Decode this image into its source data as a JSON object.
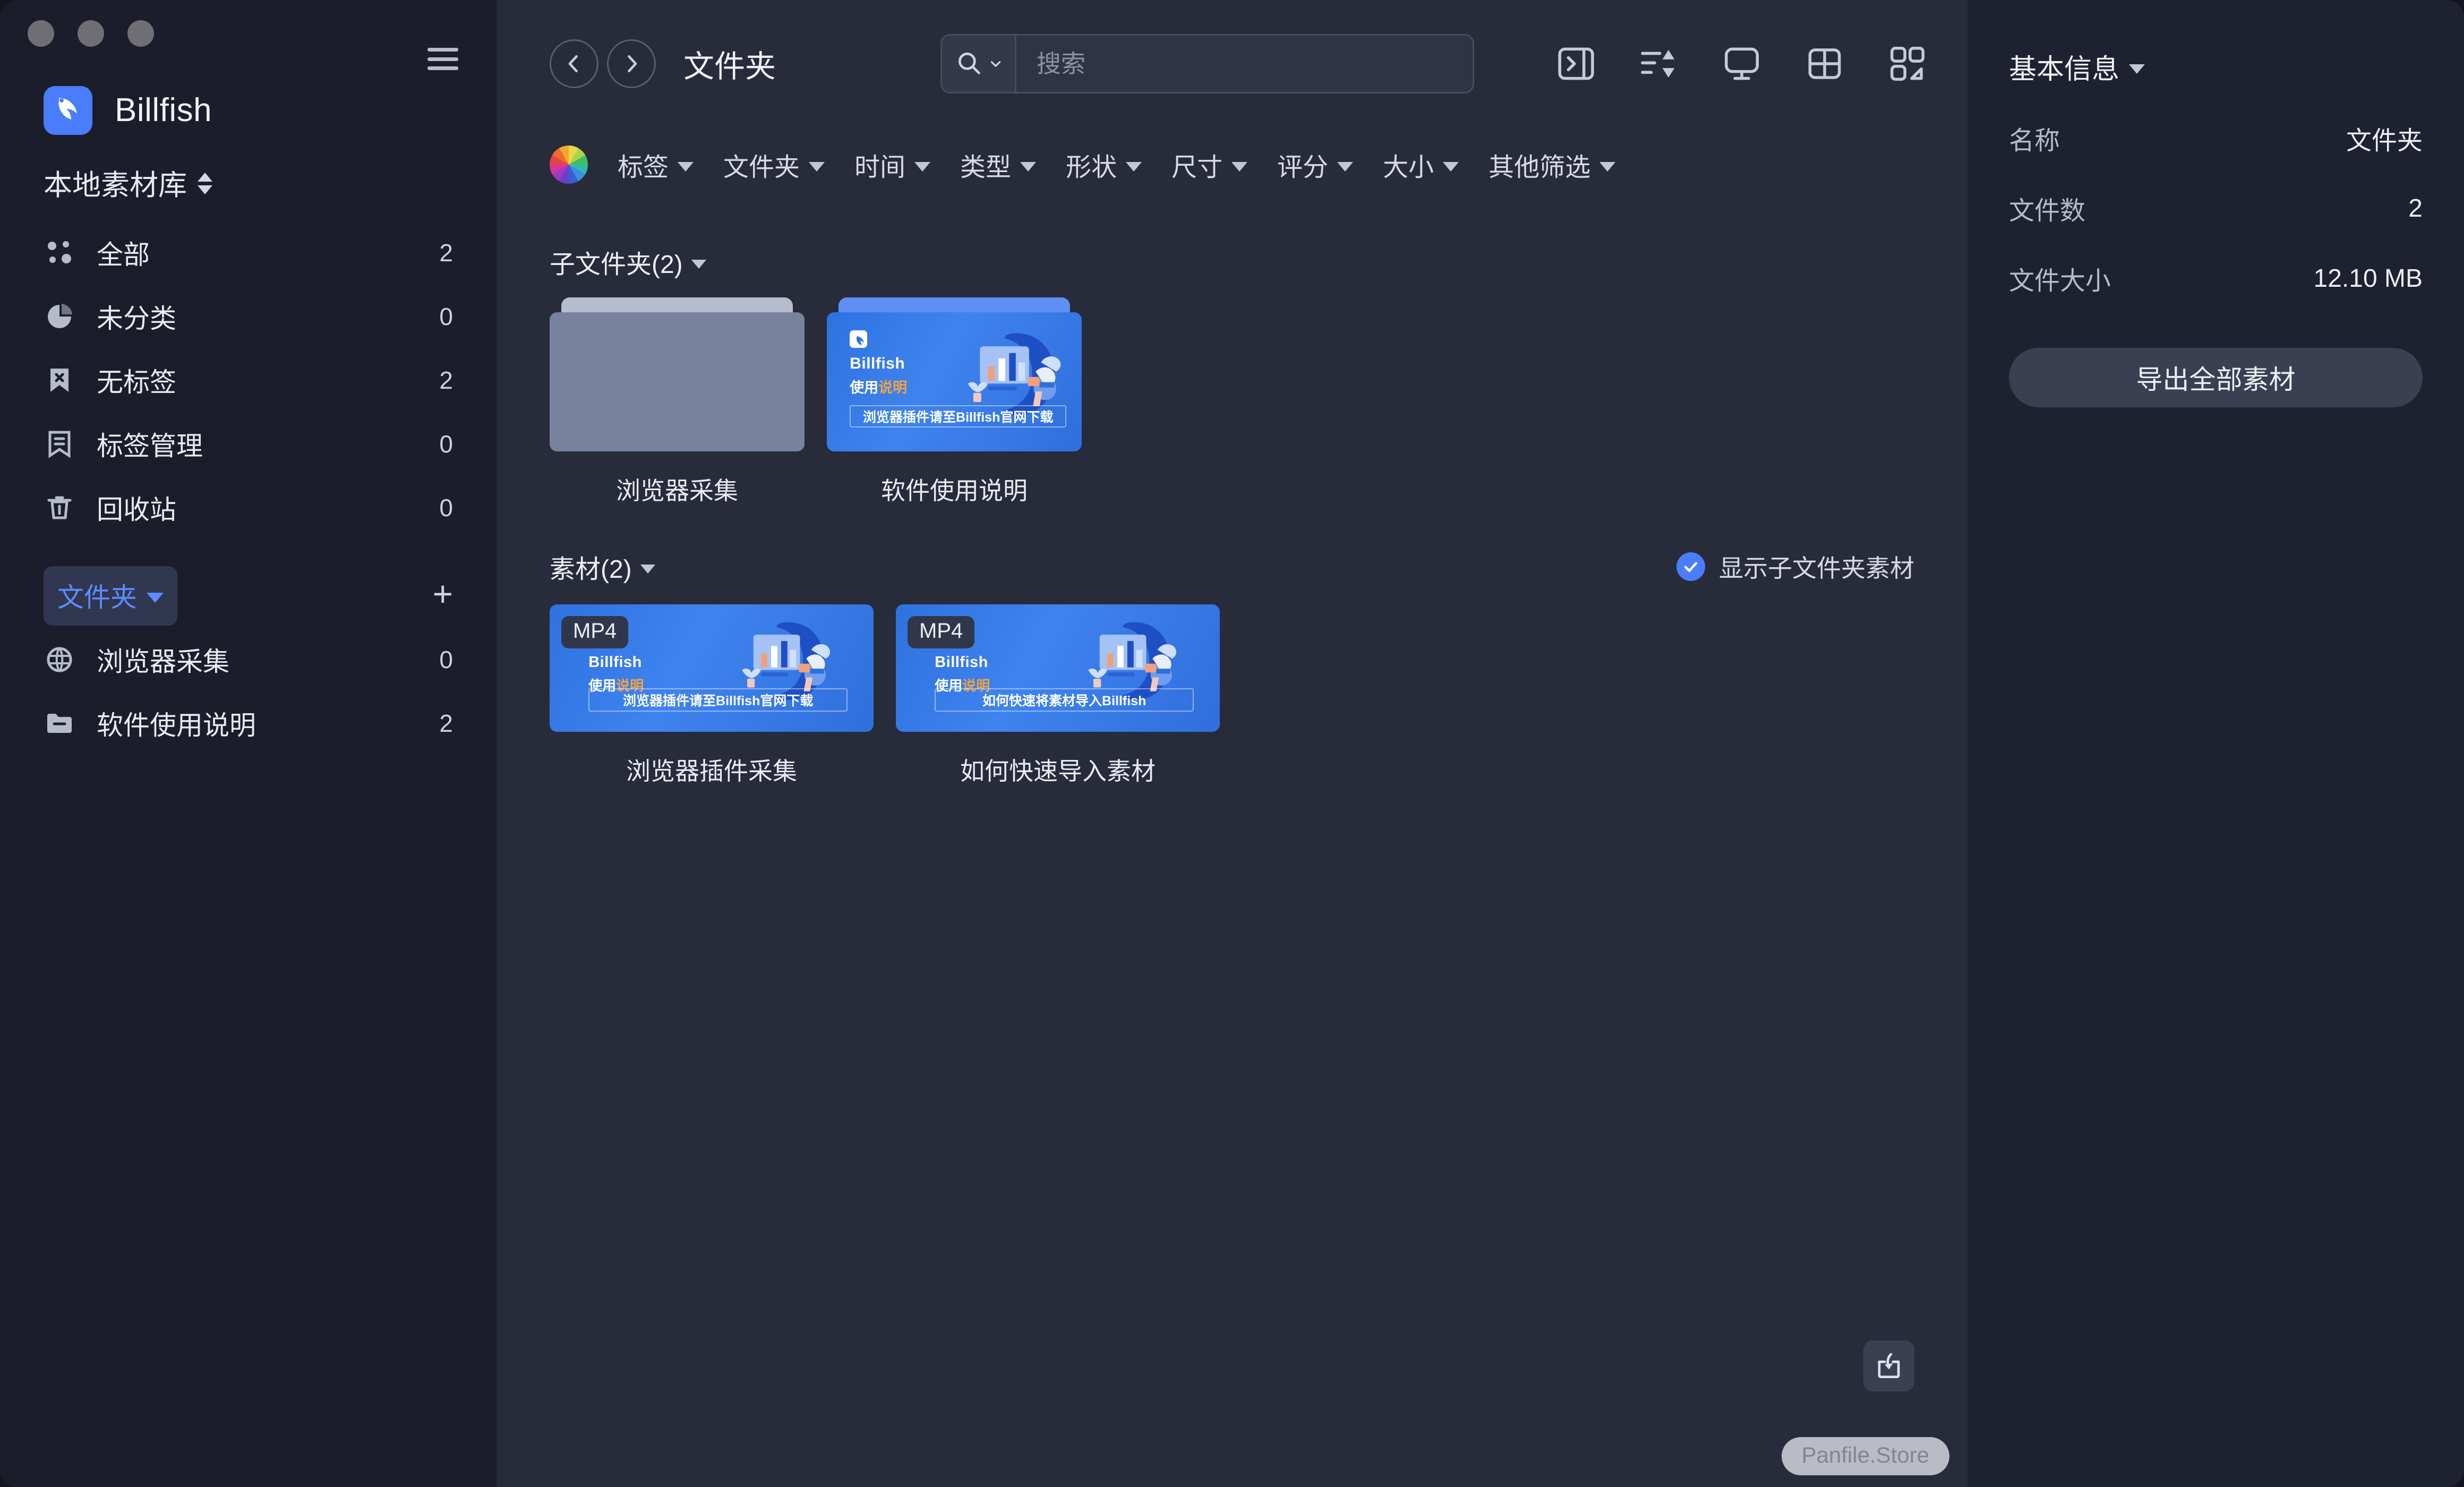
{
  "window": {
    "traffic_lights": [
      "close",
      "minimize",
      "maximize"
    ]
  },
  "sidebar": {
    "brand_name": "Billfish",
    "library_name": "本地素材库",
    "nav_items": [
      {
        "label": "全部",
        "count": "2",
        "icon": "all-dots-icon"
      },
      {
        "label": "未分类",
        "count": "0",
        "icon": "pie-chart-icon"
      },
      {
        "label": "无标签",
        "count": "2",
        "icon": "tag-off-icon"
      },
      {
        "label": "标签管理",
        "count": "0",
        "icon": "tag-manage-icon"
      },
      {
        "label": "回收站",
        "count": "0",
        "icon": "trash-icon"
      }
    ],
    "folder_section": {
      "label": "文件夹",
      "add_label": "+"
    },
    "folders": [
      {
        "label": "浏览器采集",
        "count": "0",
        "icon": "globe-folder-icon"
      },
      {
        "label": "软件使用说明",
        "count": "2",
        "icon": "folder-icon"
      }
    ]
  },
  "topbar": {
    "back_label": "‹",
    "forward_label": "›",
    "breadcrumb_title": "文件夹",
    "search_placeholder": "搜索",
    "search_value": "",
    "tool_icons": [
      "panel-toggle-icon",
      "sort-order-icon",
      "display-monitor-icon",
      "layout-grid-icon",
      "thumbnail-size-icon"
    ]
  },
  "filterbar": {
    "color_wheel": "color-wheel-icon",
    "filters": [
      "标签",
      "文件夹",
      "时间",
      "类型",
      "形状",
      "尺寸",
      "评分",
      "大小",
      "其他筛选"
    ]
  },
  "content": {
    "subfolder_group": {
      "title": "子文件夹(2)",
      "items": [
        {
          "name": "浏览器采集",
          "thumb": "empty"
        },
        {
          "name": "软件使用说明",
          "thumb": "billfish-promo-plugin"
        }
      ]
    },
    "assets_group": {
      "title": "素材(2)",
      "show_subfolder_label": "显示子文件夹素材",
      "show_subfolder_checked": true,
      "items": [
        {
          "name": "浏览器插件采集",
          "badge": "MP4",
          "banner": "浏览器插件请至Billfish官网下载"
        },
        {
          "name": "如何快速导入素材",
          "badge": "MP4",
          "banner": "如何快速将素材导入Billfish"
        }
      ]
    },
    "promo_artwork": {
      "brand": "Billfish",
      "subtitle_white": "使用",
      "subtitle_orange": "说明"
    },
    "import_fab": "import-to-library-icon",
    "watermark": "Panfile.Store"
  },
  "inspector": {
    "title": "基本信息",
    "rows": [
      {
        "key": "名称",
        "value": "文件夹"
      },
      {
        "key": "文件数",
        "value": "2"
      },
      {
        "key": "文件大小",
        "value": "12.10 MB"
      }
    ],
    "export_label": "导出全部素材"
  },
  "colors": {
    "accent_blue": "#4a7dfc",
    "sidebar_bg": "#1b1d2a",
    "main_bg": "#282b3a",
    "inspector_bg": "#1e2130",
    "promo_orange": "#f2a341"
  }
}
